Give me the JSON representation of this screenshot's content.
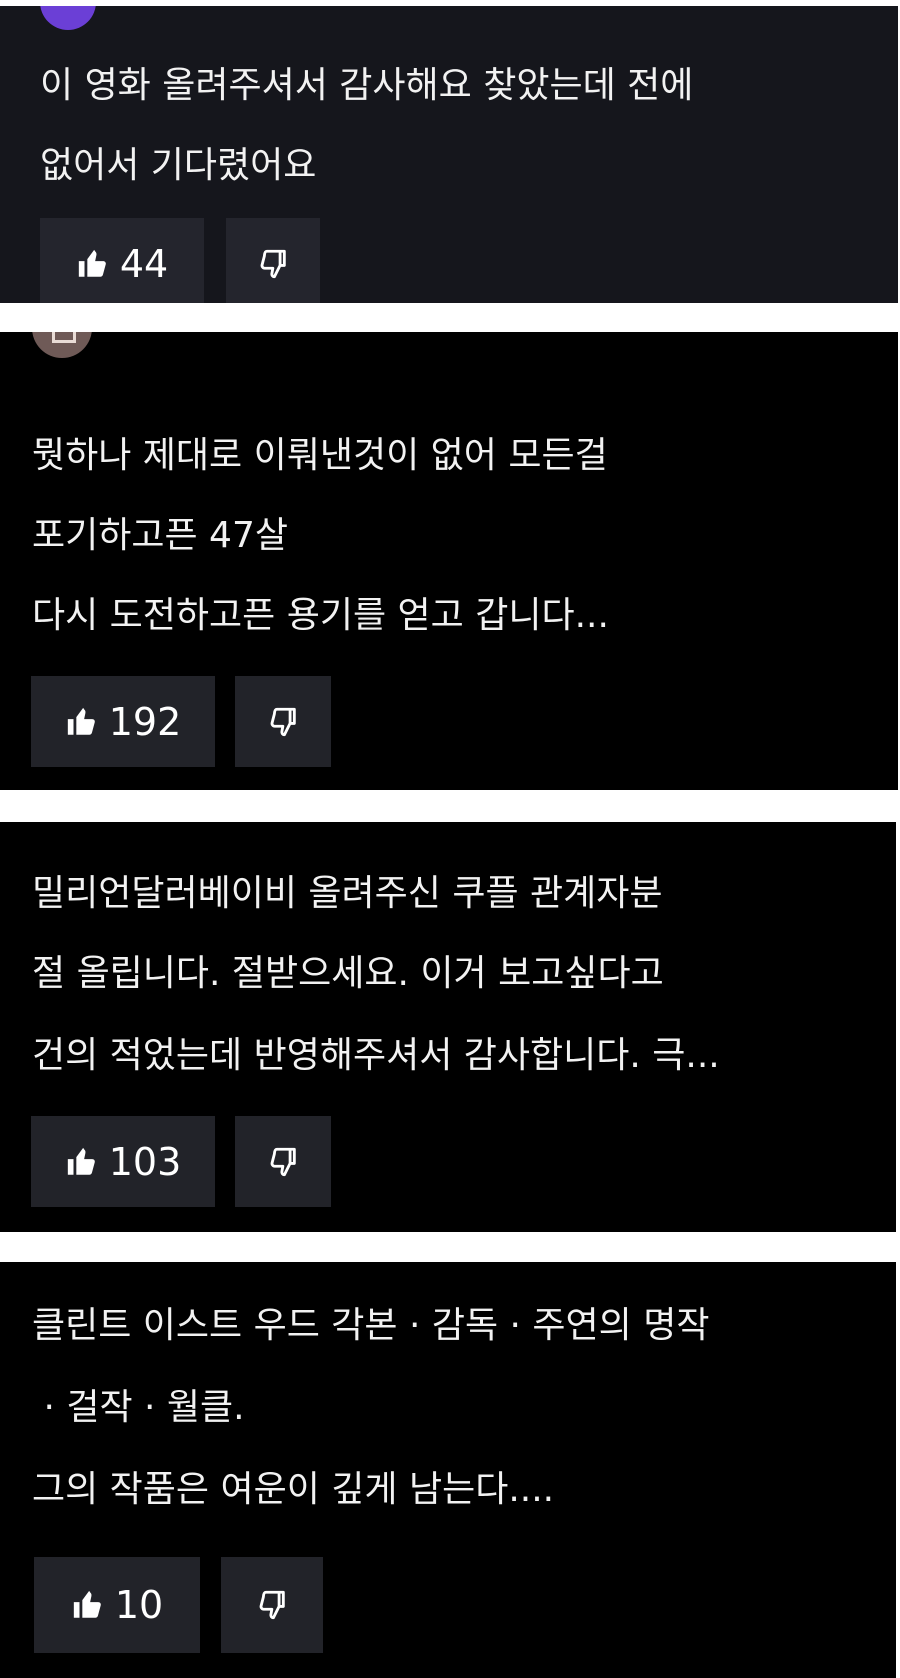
{
  "theme": {
    "card1_bg": "#15161c",
    "card_bg": "#000000",
    "button1_bg": "#24252d",
    "button_bg": "#222329",
    "avatar1_color": "#6b3fd6",
    "avatar2_color": "#6f5a57"
  },
  "comments": [
    {
      "author": "",
      "lines": [
        "이 영화 올려주셔서 감사해요 찾았는데 전에",
        "없어서 기다렸어요"
      ],
      "likes": "44"
    },
    {
      "author": "",
      "lines": [
        "뭣하나 제대로 이뤄낸것이 없어 모든걸",
        "포기하고픈 47살",
        "다시 도전하고픈 용기를 얻고 갑니다..."
      ],
      "likes": "192"
    },
    {
      "author": "",
      "lines": [
        "밀리언달러베이비 올려주신 쿠플 관계자분",
        "절 올립니다. 절받으세요. 이거 보고싶다고",
        "건의 적었는데 반영해주셔서 감사합니다. 극..."
      ],
      "likes": "103"
    },
    {
      "author": "",
      "lines": [
        "클린트 이스트 우드 각본 · 감독 · 주연의 명작",
        " · 걸작 · 월클.",
        "그의 작품은 여운이 깊게 남는다...."
      ],
      "likes": "10"
    }
  ]
}
